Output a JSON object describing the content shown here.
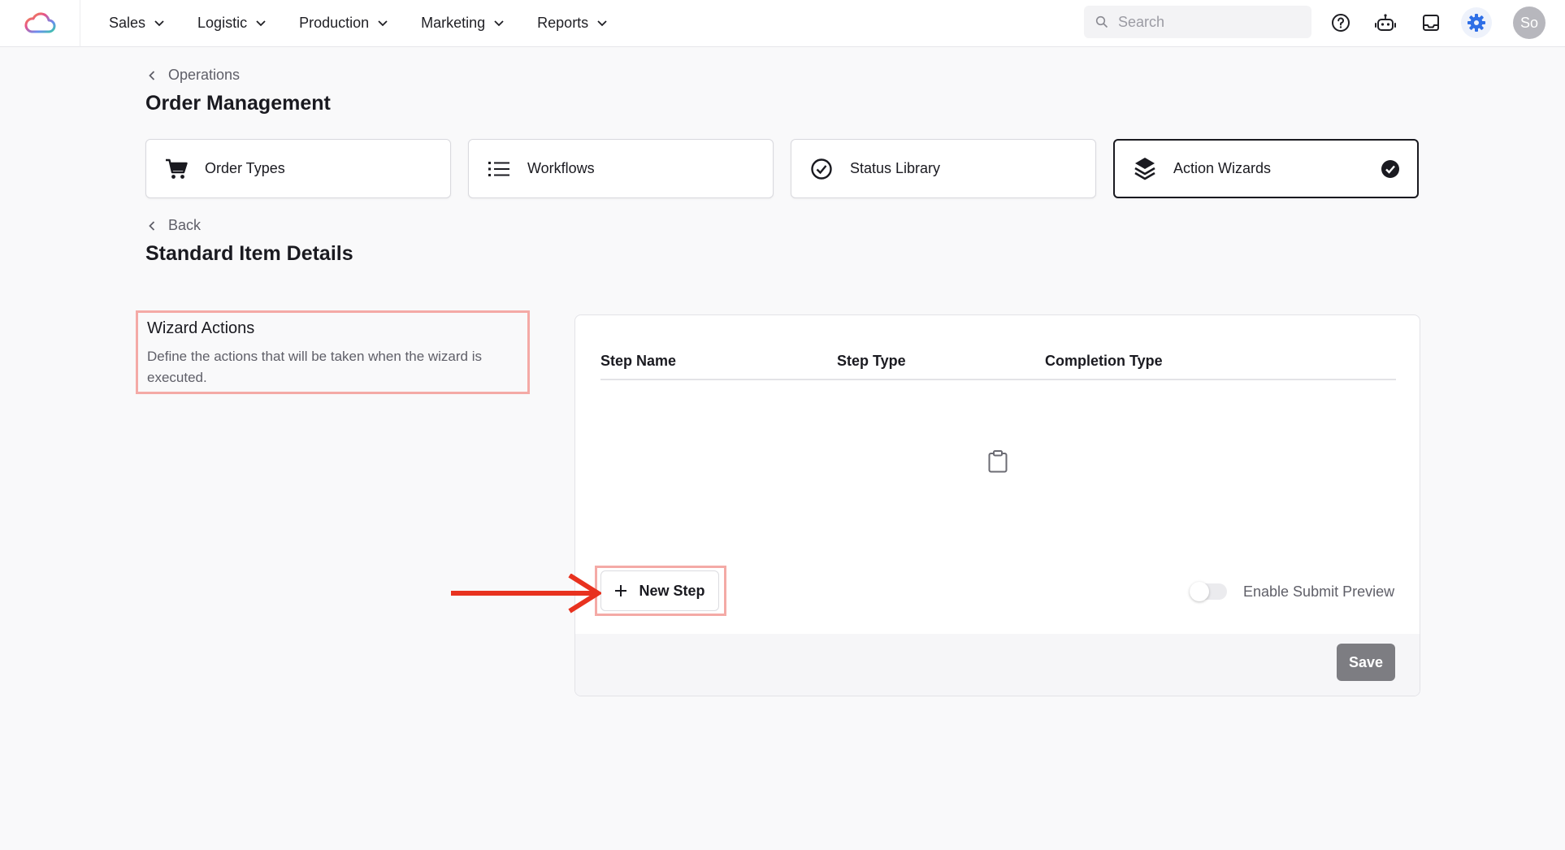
{
  "nav": {
    "logo": "cloud-logo-icon",
    "menu": [
      {
        "label": "Sales"
      },
      {
        "label": "Logistic"
      },
      {
        "label": "Production"
      },
      {
        "label": "Marketing"
      },
      {
        "label": "Reports"
      }
    ],
    "search_placeholder": "Search",
    "icons": [
      "help-circle-icon",
      "robot-icon",
      "inbox-icon",
      "gear-icon"
    ],
    "avatar_initials": "So",
    "accent_color": "#2f6fe6"
  },
  "breadcrumb": {
    "label": "Operations"
  },
  "page_title": "Order Management",
  "tabs": [
    {
      "label": "Order Types",
      "icon": "cart-icon",
      "active": false
    },
    {
      "label": "Workflows",
      "icon": "list-icon",
      "active": false
    },
    {
      "label": "Status Library",
      "icon": "check-circle-icon",
      "active": false
    },
    {
      "label": "Action Wizards",
      "icon": "layers-icon",
      "active": true
    }
  ],
  "back": {
    "label": "Back"
  },
  "detail_title": "Standard Item Details",
  "section": {
    "title": "Wizard Actions",
    "description": "Define the actions that will be taken when the wizard is executed."
  },
  "table": {
    "columns": [
      "Step Name",
      "Step Type",
      "Completion Type"
    ],
    "rows": [],
    "empty_icon": "clipboard-icon"
  },
  "actions": {
    "new_step_label": "New Step",
    "toggle_label": "Enable Submit Preview",
    "toggle_on": false,
    "save_label": "Save"
  },
  "highlight_color": "#f4aaa6",
  "arrow_color": "#e8321f"
}
